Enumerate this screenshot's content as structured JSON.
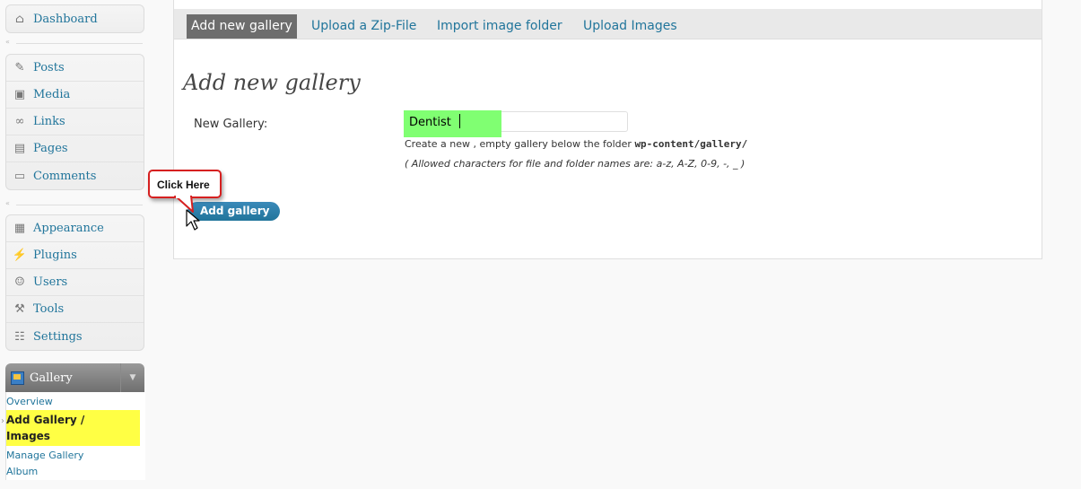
{
  "sidebar": {
    "group1": [
      {
        "label": "Dashboard",
        "icon": "home-icon"
      }
    ],
    "group2": [
      {
        "label": "Posts",
        "icon": "pushpin-icon"
      },
      {
        "label": "Media",
        "icon": "media-icon"
      },
      {
        "label": "Links",
        "icon": "link-icon"
      },
      {
        "label": "Pages",
        "icon": "pages-icon"
      },
      {
        "label": "Comments",
        "icon": "comment-icon"
      }
    ],
    "group3": [
      {
        "label": "Appearance",
        "icon": "appearance-icon"
      },
      {
        "label": "Plugins",
        "icon": "plugin-icon"
      },
      {
        "label": "Users",
        "icon": "users-icon"
      },
      {
        "label": "Tools",
        "icon": "tools-icon"
      },
      {
        "label": "Settings",
        "icon": "settings-icon"
      }
    ],
    "gallery": {
      "label": "Gallery",
      "submenu": [
        "Overview",
        "Add Gallery /",
        "Images",
        "Manage Gallery",
        "Album"
      ]
    }
  },
  "tabs": [
    "Add new gallery",
    "Upload a Zip-File",
    "Import image folder",
    "Upload Images"
  ],
  "main": {
    "title": "Add new gallery",
    "field_label": "New Gallery:",
    "field_value": "Dentist",
    "help_prefix": "Create a new , empty gallery below the folder ",
    "help_path": "wp-content/gallery/",
    "help_allowed": "( Allowed characters for file and folder names are: a-z, A-Z, 0-9, -, _ )",
    "button_label": "Add gallery"
  },
  "callout": {
    "text": "Click Here"
  },
  "colors": {
    "link": "#21759b",
    "highlight_yellow": "#ffff44",
    "highlight_green": "#80ff72",
    "callout_border": "#d62020"
  }
}
